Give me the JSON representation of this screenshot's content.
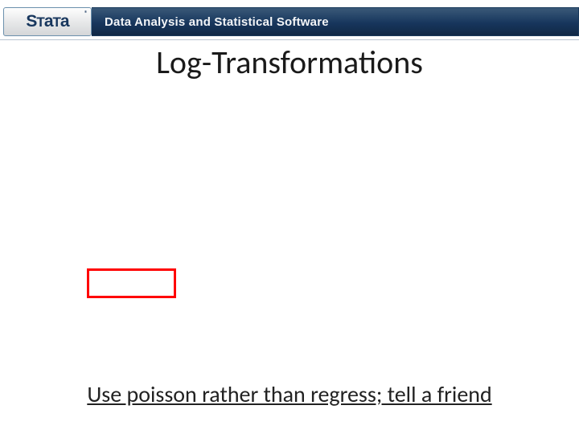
{
  "header": {
    "logo_text": "STaTa",
    "tagline": "Data Analysis and Statistical Software",
    "registered_mark": "®"
  },
  "title": "Log-Transformations",
  "highlight_box": {
    "color": "#ff0000"
  },
  "footer": {
    "text": "Use poisson rather than regress; tell a friend"
  }
}
